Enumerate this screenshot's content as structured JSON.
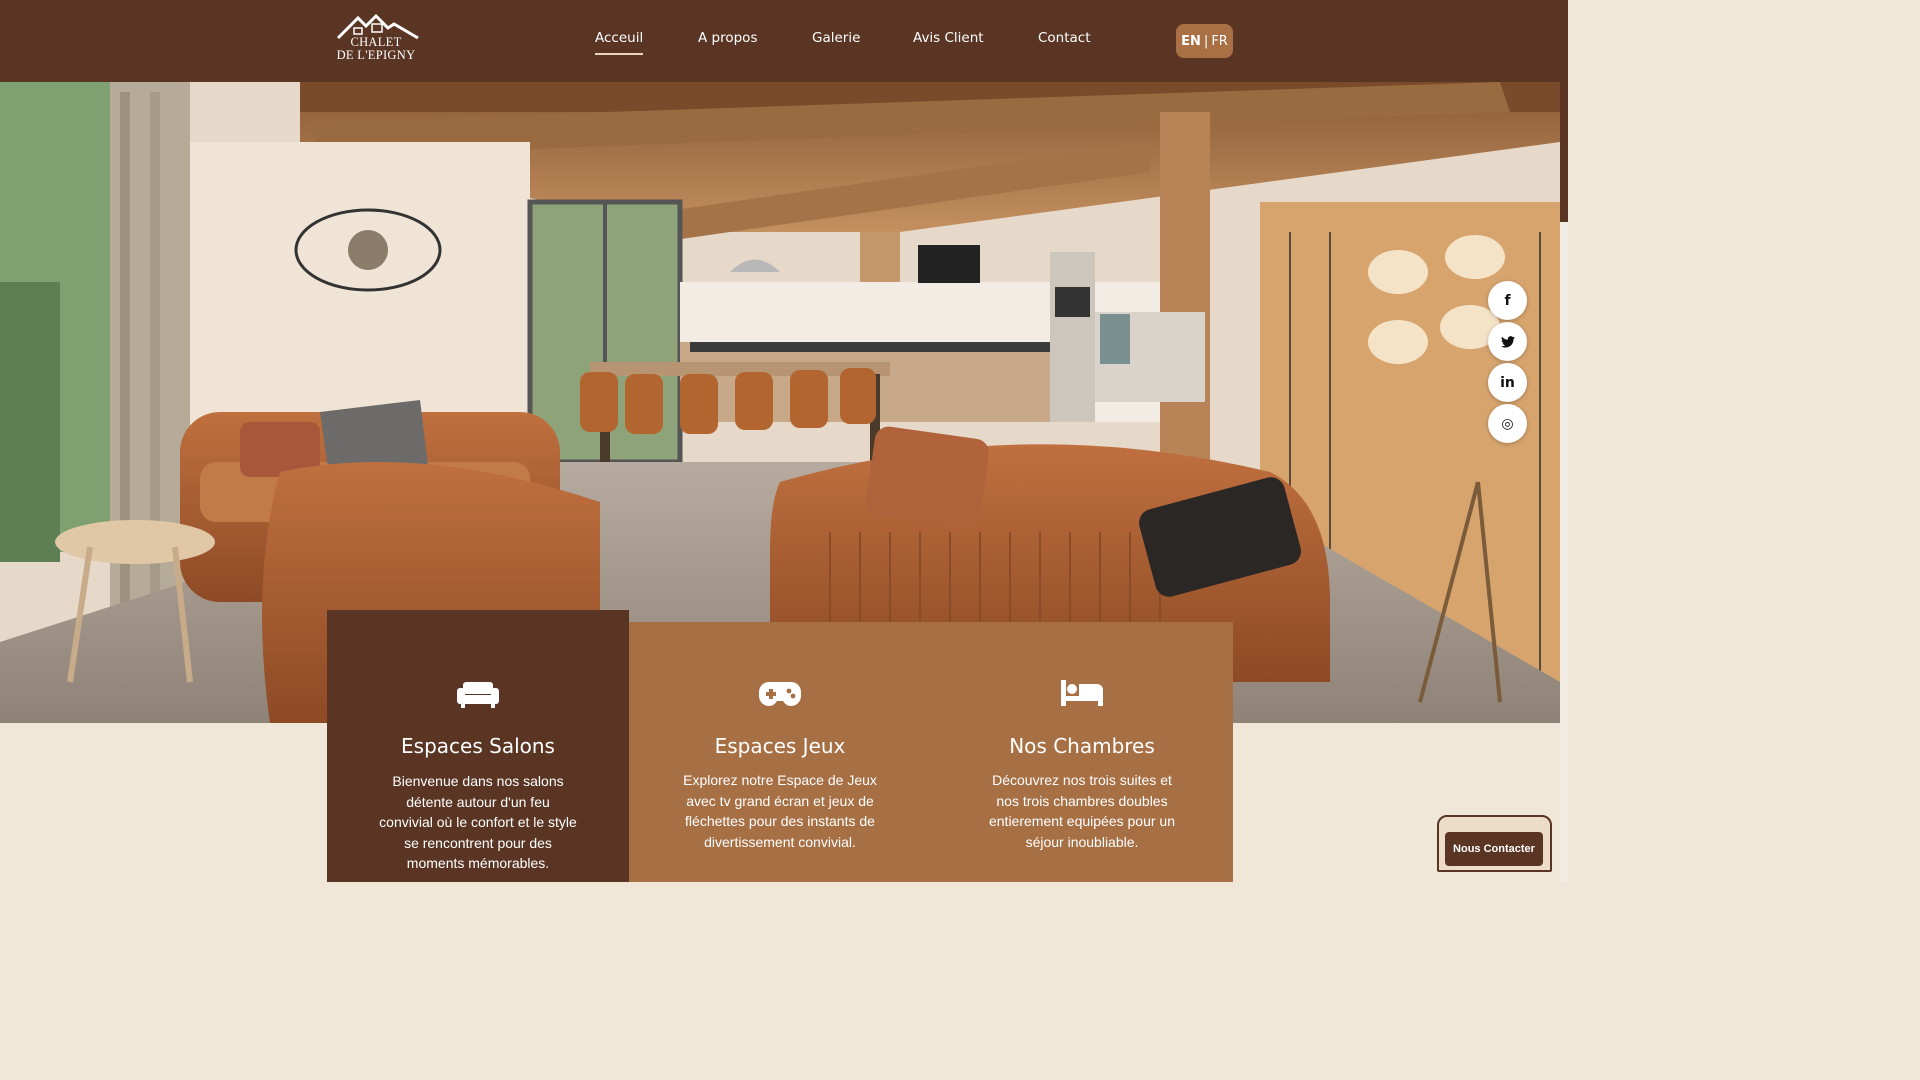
{
  "brand": {
    "logo_line1": "CHALET",
    "logo_line2": "DE L'EPIGNY"
  },
  "nav": {
    "items": [
      {
        "label": "Acceuil",
        "active": true
      },
      {
        "label": "A propos",
        "active": false
      },
      {
        "label": "Galerie",
        "active": false
      },
      {
        "label": "Avis Client",
        "active": false
      },
      {
        "label": "Contact",
        "active": false
      }
    ]
  },
  "language": {
    "en": "EN",
    "separator": "|",
    "fr": "FR",
    "selected": "EN"
  },
  "social": [
    {
      "name": "facebook-icon",
      "glyph": "f"
    },
    {
      "name": "twitter-icon",
      "glyph": "t"
    },
    {
      "name": "linkedin-icon",
      "glyph": "in"
    },
    {
      "name": "instagram-icon",
      "glyph": "◎"
    }
  ],
  "cards": [
    {
      "icon": "sofa-icon",
      "title": "Espaces Salons",
      "text": "Bienvenue dans nos salons détente autour d'un feu convivial où le confort et le style se rencontrent pour des moments mémorables."
    },
    {
      "icon": "gamepad-icon",
      "title": "Espaces Jeux",
      "text": "Explorez notre Espace de Jeux avec tv grand écran et jeux de fléchettes pour des instants de divertissement convivial."
    },
    {
      "icon": "bed-icon",
      "title": "Nos Chambres",
      "text": "Découvrez nos trois suites et nos trois chambres doubles entierement equipées pour un séjour inoubliable."
    }
  ],
  "contact_button": {
    "label": "Nous Contacter"
  },
  "colors": {
    "header": "#5a3524",
    "accent": "#a76f44",
    "background": "#f1e7d9"
  }
}
